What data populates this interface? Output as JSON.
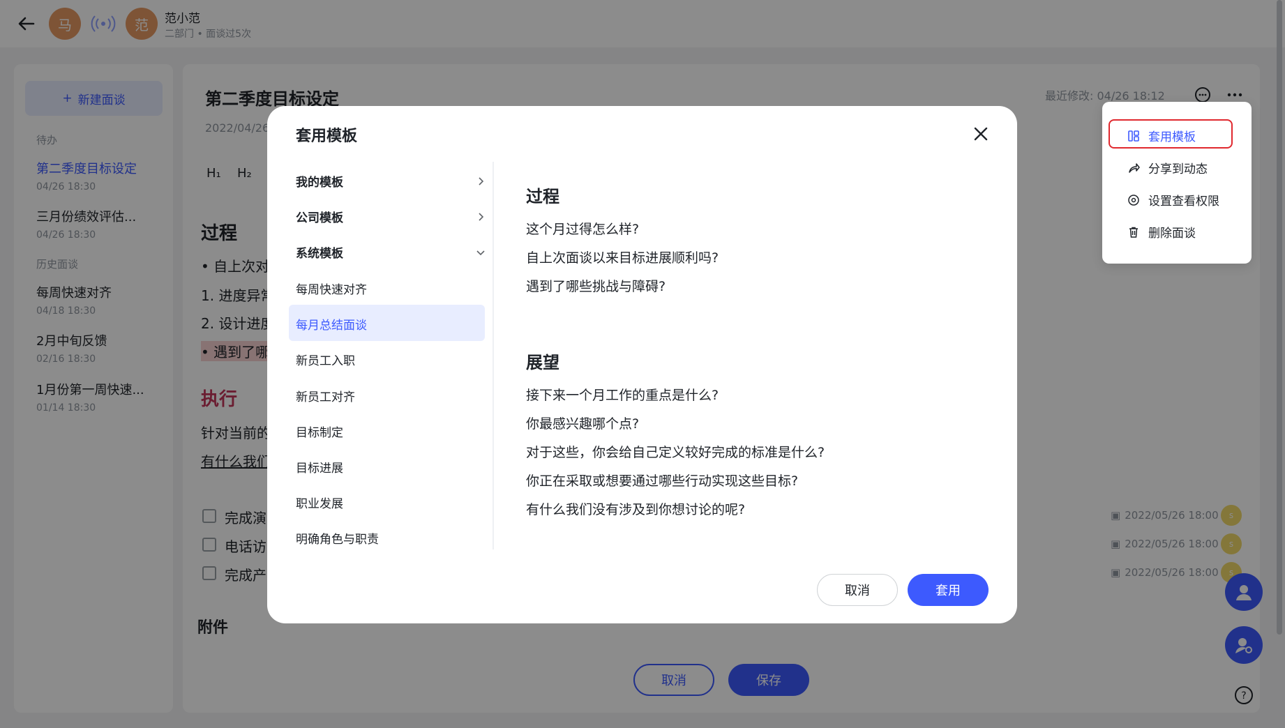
{
  "header": {
    "avatar1": "马",
    "avatar2": "范",
    "user_name": "范小范",
    "user_sub": "二部门 • 面谈过5次"
  },
  "sidebar": {
    "new_button": "新建面谈",
    "section_todo": "待办",
    "section_history": "历史面谈",
    "todo_items": [
      {
        "title": "第二季度目标设定",
        "date": "04/26 18:30"
      },
      {
        "title": "三月份绩效评估...",
        "date": "04/26 18:30"
      }
    ],
    "history_items": [
      {
        "title": "每周快速对齐",
        "date": "04/18 18:30"
      },
      {
        "title": "2月中旬反馈",
        "date": "02/16 18:30"
      },
      {
        "title": "1月份第一周快速...",
        "date": "01/14 18:30"
      }
    ]
  },
  "document": {
    "title": "第二季度目标设定",
    "date": "2022/04/26",
    "last_modified": "最近修改: 04/26 18:12",
    "toolbar": {
      "h1": "H₁",
      "h2": "H₂"
    },
    "bg_heading_1": "过程",
    "bg_line_1": "• 自上次对",
    "bg_line_2": "1. 进度异常",
    "bg_line_3": "2. 设计进度",
    "bg_line_4": "• 遇到了哪",
    "bg_heading_2": "执行",
    "bg_line_5": "针对当前的",
    "bg_line_6": "有什么我们",
    "tasks": [
      {
        "text": "完成演",
        "date": "2022/05/26 18:00"
      },
      {
        "text": "电话访",
        "date": "2022/05/26 18:00"
      },
      {
        "text": "完成产",
        "date": "2022/05/26 18:00"
      }
    ],
    "attachments": "附件",
    "cancel": "取消",
    "save": "保存"
  },
  "menu": {
    "items": [
      {
        "label": "套用模板",
        "icon": "template-icon"
      },
      {
        "label": "分享到动态",
        "icon": "share-icon"
      },
      {
        "label": "设置查看权限",
        "icon": "permission-icon"
      },
      {
        "label": "删除面谈",
        "icon": "trash-icon"
      }
    ]
  },
  "modal": {
    "title": "套用模板",
    "groups": [
      {
        "label": "我的模板"
      },
      {
        "label": "公司模板"
      },
      {
        "label": "系统模板"
      }
    ],
    "system_templates": [
      "每周快速对齐",
      "每月总结面谈",
      "新员工入职",
      "新员工对齐",
      "目标制定",
      "目标进展",
      "职业发展",
      "明确角色与职责"
    ],
    "selected": "每月总结面谈",
    "preview": {
      "heading_1": "过程",
      "lines_1": [
        "这个月过得怎么样?",
        "自上次面谈以来目标进展顺利吗?",
        "遇到了哪些挑战与障碍?"
      ],
      "heading_2": "展望",
      "lines_2": [
        "接下来一个月工作的重点是什么?",
        "你最感兴趣哪个点?",
        "对于这些，你会给自己定义较好完成的标准是什么?",
        "你正在采取或想要通过哪些行动实现这些目标?",
        "有什么我们没有涉及到你想讨论的呢?"
      ]
    },
    "cancel": "取消",
    "apply": "套用"
  },
  "colors": {
    "accent": "#3d5afe",
    "highlight_border": "#e0282e"
  }
}
